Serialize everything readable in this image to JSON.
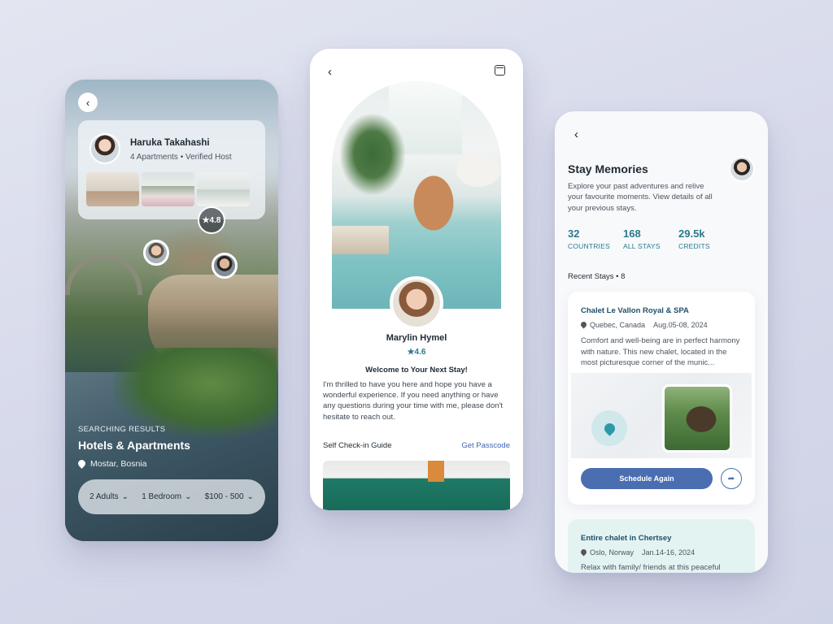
{
  "screen1": {
    "host_name": "Haruka Takahashi",
    "host_meta": "4 Apartments  •  Verified Host",
    "rating": "4.8",
    "search_tag": "SEARCHING RESULTS",
    "title": "Hotels & Apartments",
    "location": "Mostar, Bosnia",
    "filters": [
      {
        "label": "2 Adults"
      },
      {
        "label": "1 Bedroom"
      },
      {
        "label": "$100 - 500"
      }
    ]
  },
  "screen2": {
    "host_name": "Marylin Hymel",
    "rating": "★4.6",
    "welcome_title": "Welcome to Your Next Stay!",
    "welcome_body": "I'm thrilled to have you here and hope you have a wonderful experience. If you need anything or have any questions during your time with me, please don't hesitate to reach out.",
    "guide_title": "Self Check-in Guide",
    "guide_link": "Get Passcode"
  },
  "screen3": {
    "title": "Stay Memories",
    "description": "Explore your past adventures and relive your favourite moments. View details of all your previous stays.",
    "stats": [
      {
        "value": "32",
        "label": "COUNTRIES"
      },
      {
        "value": "168",
        "label": "ALL STAYS"
      },
      {
        "value": "29.5k",
        "label": "CREDITS"
      }
    ],
    "recent_label": "Recent Stays  •  8",
    "stay1": {
      "name": "Chalet Le Vallon Royal & SPA",
      "location": "Quebec, Canada",
      "dates": "Aug.05-08, 2024",
      "description": "Comfort and well-being are in perfect harmony with nature. This new chalet, located in the most picturesque corner of the munic...",
      "button": "Schedule Again"
    },
    "stay2": {
      "name": "Entire chalet in Chertsey",
      "location": "Oslo, Norway",
      "dates": "Jan.14-16, 2024",
      "description": "Relax with family/ friends at this peaceful"
    }
  },
  "colors": {
    "accent_teal": "#2b7a8c",
    "button_blue": "#4a6eb0",
    "background": "#d6d9ea"
  }
}
